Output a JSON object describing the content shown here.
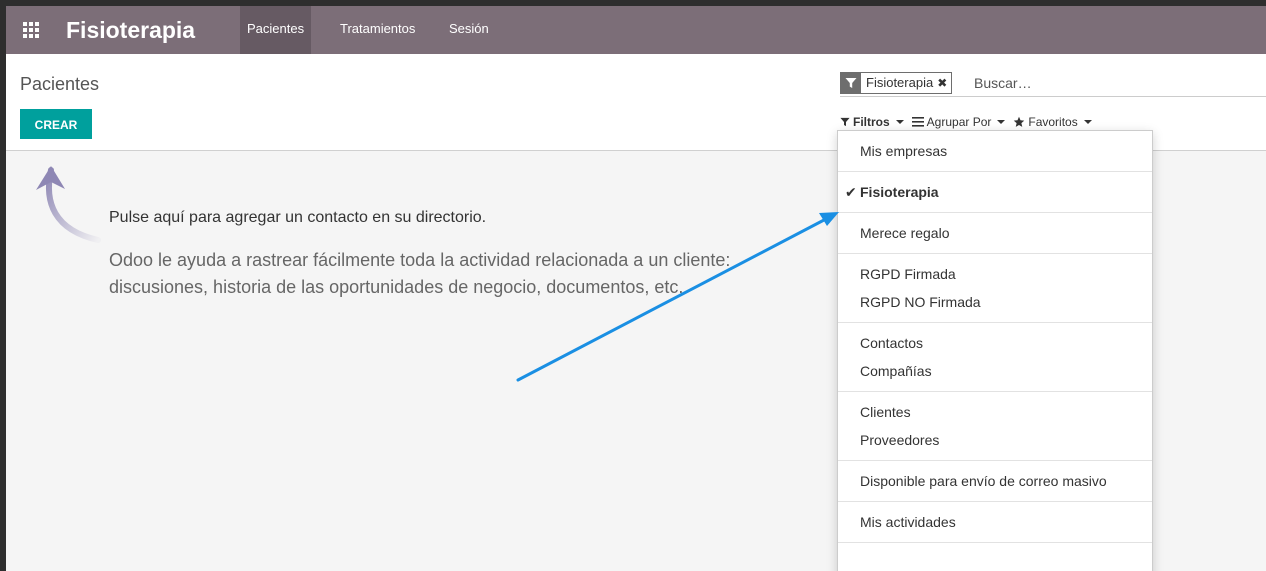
{
  "navbar": {
    "brand": "Fisioterapia",
    "menu": [
      "Pacientes",
      "Tratamientos",
      "Sesión"
    ]
  },
  "control_panel": {
    "breadcrumb": "Pacientes",
    "create_label": "CREAR",
    "search": {
      "facet_label": "Fisioterapia",
      "facet_remove": "✖",
      "placeholder": "Buscar…"
    },
    "options": {
      "filters": "Filtros",
      "group_by": "Agrupar Por",
      "favorites": "Favoritos"
    }
  },
  "help": {
    "title": "Pulse aquí para agregar un contacto en su directorio.",
    "body": "Odoo le ayuda a rastrear fácilmente toda la actividad relacionada a un cliente: discusiones, historia de las oportunidades de negocio, documentos, etc."
  },
  "filter_dropdown": {
    "check": "✔",
    "groups": [
      [
        "Mis empresas"
      ],
      [
        "Fisioterapia"
      ],
      [
        "Merece regalo"
      ],
      [
        "RGPD Firmada",
        "RGPD NO Firmada"
      ],
      [
        "Contactos",
        "Compañías"
      ],
      [
        "Clientes",
        "Proveedores"
      ],
      [
        "Disponible para envío de correo masivo"
      ],
      [
        "Mis actividades"
      ]
    ]
  },
  "colors": {
    "navbar": "#7c6e78",
    "primary_button": "#00a09d",
    "annotation_arrow": "#1a8fe3"
  }
}
